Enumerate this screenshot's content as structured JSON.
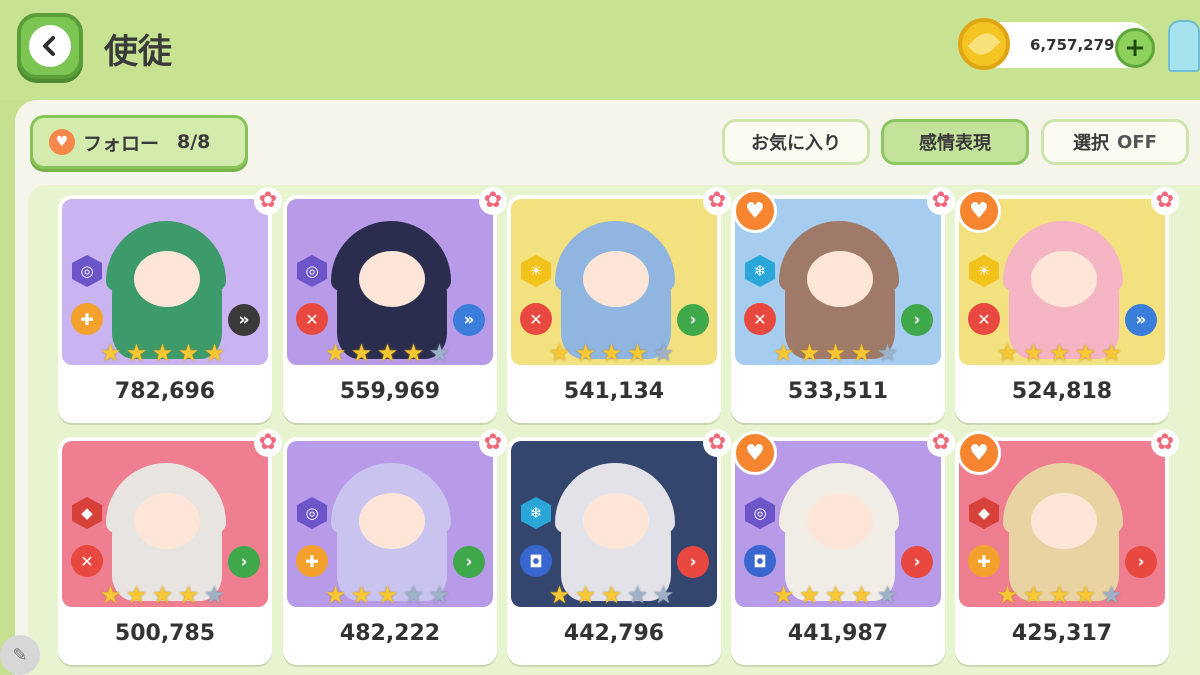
{
  "header": {
    "title": "使徒",
    "currency_amount": "6,757,279",
    "plus_label": "+"
  },
  "toolbar": {
    "follow_label": "フォロー",
    "follow_count": "8/8",
    "favorites_label": "お気に入り",
    "emotion_label": "感情表現",
    "select_label": "選択",
    "select_state": "OFF"
  },
  "icons": {
    "back": "chevron-left-icon",
    "coin": "leaf-coin-icon",
    "heart": "heart-icon",
    "flower": "flower-icon",
    "star": "star-icon",
    "pen": "pen-icon"
  },
  "colors": {
    "accent_green": "#7cc552",
    "star_filled": "#f7c833",
    "heart_orange": "#f7842f",
    "favorite_pink": "#f0687a"
  },
  "cards": [
    {
      "power": "782,696",
      "stars": 5,
      "favorite": true,
      "followed": false,
      "element_glyph": "◎",
      "element_color": "#6b55c9",
      "role_glyph": "✚",
      "role_color": "#f4a02d",
      "rank_glyph": "»",
      "rank_color": "#3a3a3a",
      "bg": "#c9b3f0",
      "hair": "#3d9a6a"
    },
    {
      "power": "559,969",
      "stars": 4,
      "favorite": true,
      "followed": false,
      "element_glyph": "◎",
      "element_color": "#6b55c9",
      "role_glyph": "✕",
      "role_color": "#e8483f",
      "rank_glyph": "»",
      "rank_color": "#3a7ddb",
      "bg": "#b89be8",
      "hair": "#2a2d4e"
    },
    {
      "power": "541,134",
      "stars": 4,
      "favorite": true,
      "followed": false,
      "element_glyph": "☀",
      "element_color": "#f2c21a",
      "role_glyph": "✕",
      "role_color": "#e8483f",
      "rank_glyph": "›",
      "rank_color": "#3fa84a",
      "bg": "#f3e07f",
      "hair": "#8fb5e0"
    },
    {
      "power": "533,511",
      "stars": 4,
      "favorite": true,
      "followed": true,
      "element_glyph": "❄",
      "element_color": "#2aa6d9",
      "role_glyph": "✕",
      "role_color": "#e8483f",
      "rank_glyph": "›",
      "rank_color": "#3fa84a",
      "bg": "#a6cdef",
      "hair": "#a07a68"
    },
    {
      "power": "524,818",
      "stars": 5,
      "favorite": true,
      "followed": true,
      "element_glyph": "☀",
      "element_color": "#f2c21a",
      "role_glyph": "✕",
      "role_color": "#e8483f",
      "rank_glyph": "»",
      "rank_color": "#3a7ddb",
      "bg": "#f3e07f",
      "hair": "#f4b4c4"
    },
    {
      "power": "500,785",
      "stars": 4,
      "favorite": true,
      "followed": false,
      "element_glyph": "◆",
      "element_color": "#d8413a",
      "role_glyph": "✕",
      "role_color": "#e8483f",
      "rank_glyph": "›",
      "rank_color": "#3fa84a",
      "bg": "#ef7f90",
      "hair": "#e8e4e2"
    },
    {
      "power": "482,222",
      "stars": 3,
      "favorite": true,
      "followed": false,
      "element_glyph": "◎",
      "element_color": "#6b55c9",
      "role_glyph": "✚",
      "role_color": "#f4a02d",
      "rank_glyph": "›",
      "rank_color": "#3fa84a",
      "bg": "#b89be8",
      "hair": "#c9c3ef"
    },
    {
      "power": "442,796",
      "stars": 3,
      "favorite": true,
      "followed": false,
      "element_glyph": "❄",
      "element_color": "#2aa6d9",
      "role_glyph": "◘",
      "role_color": "#3a66d0",
      "rank_glyph": "›",
      "rank_color": "#e8483f",
      "bg": "#34466e",
      "hair": "#e2e2e8"
    },
    {
      "power": "441,987",
      "stars": 4,
      "favorite": true,
      "followed": true,
      "element_glyph": "◎",
      "element_color": "#6b55c9",
      "role_glyph": "◘",
      "role_color": "#3a66d0",
      "rank_glyph": "›",
      "rank_color": "#e8483f",
      "bg": "#b89be8",
      "hair": "#f1ece6"
    },
    {
      "power": "425,317",
      "stars": 4,
      "favorite": true,
      "followed": true,
      "element_glyph": "◆",
      "element_color": "#d8413a",
      "role_glyph": "✚",
      "role_color": "#f4a02d",
      "rank_glyph": "›",
      "rank_color": "#e8483f",
      "bg": "#ef7f90",
      "hair": "#ead3a3"
    }
  ]
}
